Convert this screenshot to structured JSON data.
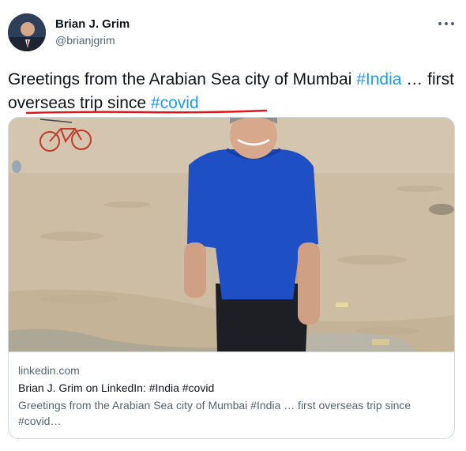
{
  "author": {
    "name": "Brian J. Grim",
    "handle": "@brianjgrim"
  },
  "tweet": {
    "text_before_first_tag": "Greetings from the Arabian Sea city of Mumbai ",
    "tag_1": "#India",
    "text_middle": " … first overseas trip since ",
    "tag_2": "#covid"
  },
  "link_card": {
    "domain": "linkedin.com",
    "title": "Brian J. Grim on LinkedIn: #India #covid",
    "description": "Greetings from the Arabian Sea city of Mumbai #India … first overseas trip since #covid…"
  },
  "colors": {
    "link": "#1d9bf0",
    "annotation": "#e0161b",
    "sand": "#cdbda4",
    "shirt": "#1f4fc4"
  },
  "icons": {
    "more": "more-dots-icon"
  }
}
